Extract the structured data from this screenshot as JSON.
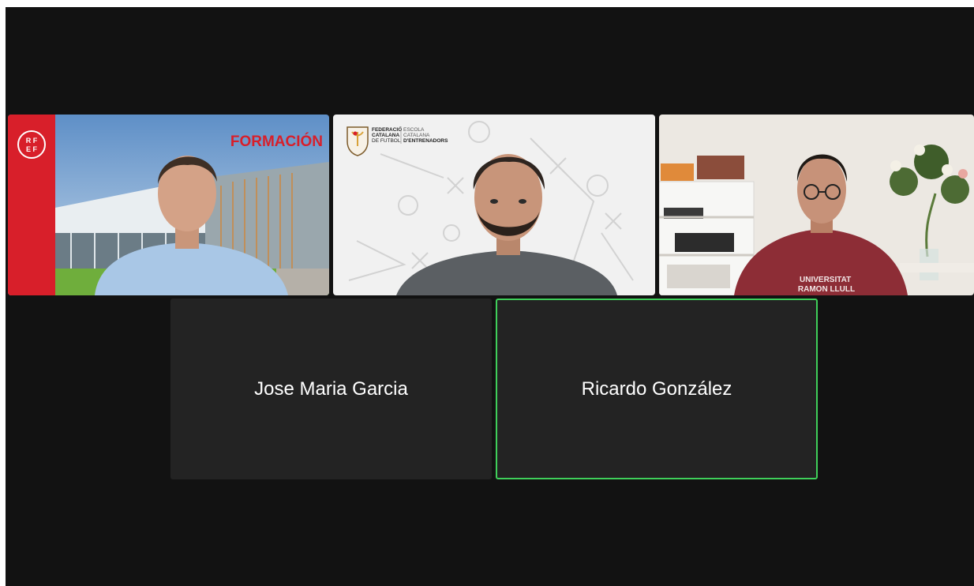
{
  "colors": {
    "background": "#121212",
    "tile_background": "#232323",
    "active_speaker_border": "#3fcf5a",
    "name_text": "#ffffff"
  },
  "video_tiles": [
    {
      "id": "tile-1",
      "logo_text": "RF EF",
      "banner_text": "FORMACIÓN",
      "description": "speaker in light blue sweater in front of modern building"
    },
    {
      "id": "tile-2",
      "logo_left_lines": [
        "FEDERACIÓ",
        "CATALANA",
        "DE FUTBOL"
      ],
      "logo_right_lines": [
        "ESCOLA",
        "CATALANA",
        "D'ENTRENADORS"
      ]
    },
    {
      "id": "tile-3",
      "shirt_text": [
        "UNIVERSITAT",
        "RAMON LLULL"
      ]
    }
  ],
  "participants": [
    {
      "name": "Jose Maria Garcia",
      "active": false
    },
    {
      "name": "Ricardo González",
      "active": true
    }
  ]
}
